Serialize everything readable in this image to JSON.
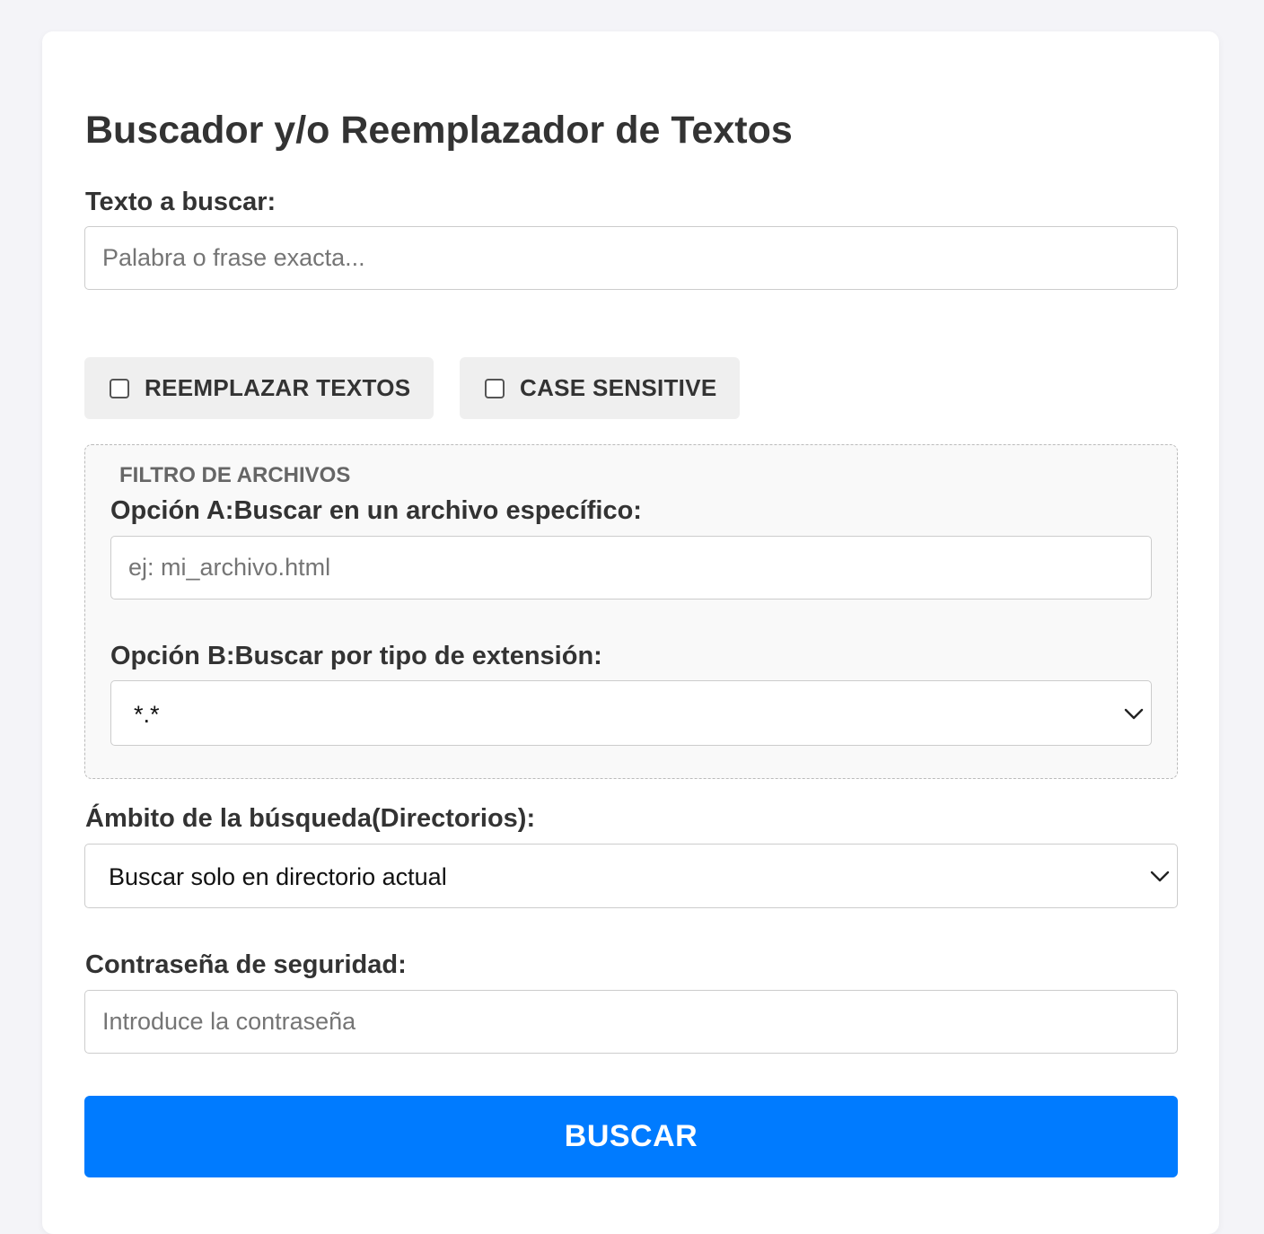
{
  "header": {
    "title": "Buscador y/o Reemplazador de Textos"
  },
  "search": {
    "label": "Texto a buscar:",
    "placeholder": "Palabra o frase exacta...",
    "value": ""
  },
  "options": {
    "replace": {
      "label": "REEMPLAZAR TEXTOS",
      "checked": false
    },
    "case_sensitive": {
      "label": "CASE SENSITIVE",
      "checked": false
    }
  },
  "file_filter": {
    "legend": "FILTRO DE ARCHIVOS",
    "option_a": {
      "label": "Opción A:Buscar en un archivo específico:",
      "placeholder": "ej: mi_archivo.html",
      "value": ""
    },
    "option_b": {
      "label": "Opción B:Buscar por tipo de extensión:",
      "selected": "*.*"
    }
  },
  "scope": {
    "label": "Ámbito de la búsqueda(Directorios):",
    "selected": "Buscar solo en directorio actual"
  },
  "password": {
    "label": "Contraseña de seguridad:",
    "placeholder": "Introduce la contraseña",
    "value": ""
  },
  "actions": {
    "submit_label": "BUSCAR"
  },
  "colors": {
    "page_background": "#f4f4f8",
    "card_background": "#ffffff",
    "primary_button": "#007bff",
    "option_background": "#efefef",
    "filter_background": "#f9f9f9"
  },
  "icons": {
    "select_arrow": "chevron-down-icon",
    "checkbox": "checkbox-unchecked-icon"
  }
}
